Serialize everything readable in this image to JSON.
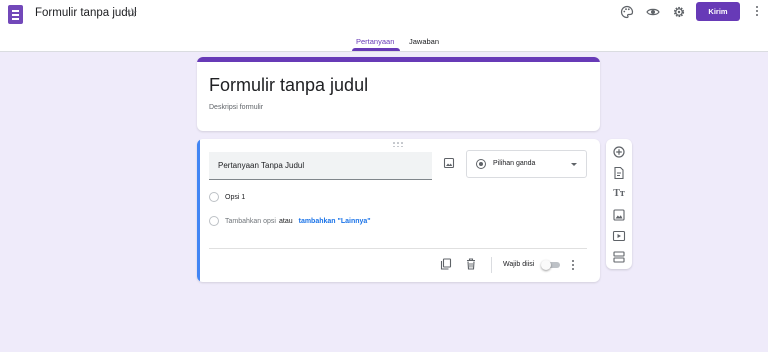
{
  "header": {
    "doc_title": "Formulir tanpa judul",
    "send_label": "Kirim",
    "icons": [
      "palette-icon",
      "eye-preview-icon",
      "gear-icon",
      "more-vert-icon"
    ],
    "accent_color": "#673ab7"
  },
  "tabs": [
    {
      "label": "Pertanyaan",
      "active": true
    },
    {
      "label": "Jawaban",
      "active": false
    }
  ],
  "form": {
    "title": "Formulir tanpa judul",
    "description_placeholder": "Deskripsi formulir"
  },
  "question": {
    "title": "Pertanyaan Tanpa Judul",
    "type": "Pilihan ganda",
    "options": [
      "Opsi 1"
    ],
    "add_option_label": "Tambahkan opsi",
    "or_label": "atau",
    "add_other_label": "tambahkan \"Lainnya\"",
    "required_label": "Wajib diisi",
    "required": false
  },
  "side_toolbar": [
    "add-question-icon",
    "import-questions-icon",
    "add-title-icon",
    "add-image-icon",
    "add-video-icon",
    "add-section-icon"
  ]
}
